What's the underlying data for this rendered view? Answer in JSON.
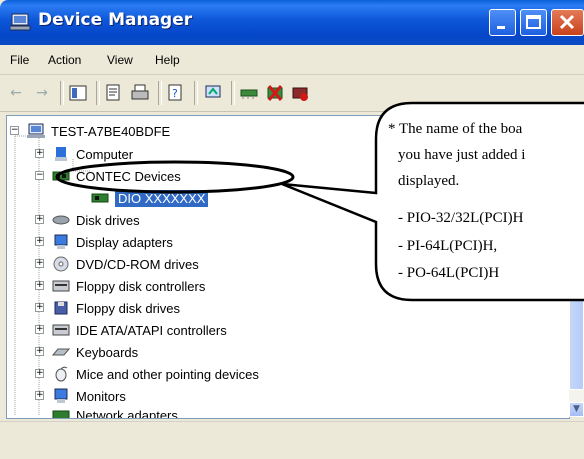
{
  "window": {
    "title": "Device Manager"
  },
  "menu": [
    "File",
    "Action",
    "View",
    "Help"
  ],
  "tree": {
    "root": "TEST-A7BE40BDFE",
    "items": [
      "Computer",
      "CONTEC Devices",
      "DIO XXXXXXX",
      "Disk drives",
      "Display adapters",
      "DVD/CD-ROM drives",
      "Floppy disk controllers",
      "Floppy disk drives",
      "IDE ATA/ATAPI controllers",
      "Keyboards",
      "Mice and other pointing devices",
      "Monitors",
      "Network adapters"
    ]
  },
  "callout": {
    "lines": [
      "* The name of the boa",
      "you have just added i",
      "displayed.",
      "- PIO-32/32L(PCI)H",
      "- PI-64L(PCI)H,",
      "- PO-64L(PCI)H"
    ]
  },
  "colors": {
    "titlebar": "#0a55d8",
    "selection": "#316ac5",
    "chrome": "#ece9d8"
  },
  "icons": [
    "device-manager-icon",
    "minimize-icon",
    "maximize-icon",
    "close-icon",
    "back-arrow-icon",
    "forward-arrow-icon",
    "properties-icon",
    "print-icon",
    "help-icon",
    "scan-icon",
    "uninstall-icon",
    "disable-icon",
    "update-driver-icon"
  ]
}
